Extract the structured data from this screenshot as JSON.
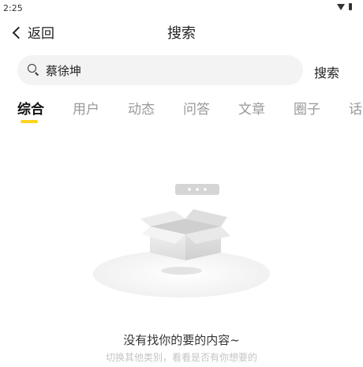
{
  "status_bar": {
    "time": "2:25"
  },
  "header": {
    "back_label": "返回",
    "title": "搜索"
  },
  "search": {
    "query": "蔡徐坤",
    "submit_label": "搜索"
  },
  "tabs": [
    {
      "label": "综合",
      "active": true
    },
    {
      "label": "用户"
    },
    {
      "label": "动态"
    },
    {
      "label": "问答"
    },
    {
      "label": "文章"
    },
    {
      "label": "圈子"
    },
    {
      "label": "话"
    }
  ],
  "empty_state": {
    "title": "没有找你的要的内容~",
    "subtitle": "切换其他类别，看看是否有你想要的"
  },
  "colors": {
    "accent": "#ffd21e",
    "search_bg": "#f3f3f4",
    "tab_inactive": "#999999"
  }
}
